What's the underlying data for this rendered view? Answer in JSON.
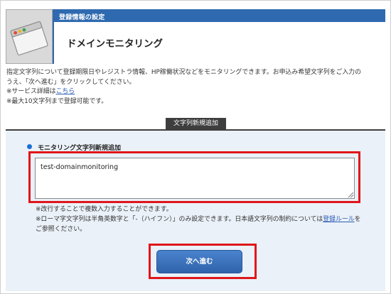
{
  "header": {
    "subtitle": "登録情報の設定",
    "title": "ドメインモニタリング"
  },
  "description": {
    "line1": "指定文字列について登録期限日やレジストラ情報、HP稼働状況などをモニタリングできます。お申込み希望文字列をご入力の",
    "line2": "うえ、「次へ進む」をクリックしてください。",
    "line3_prefix": "※サービス詳細は",
    "line3_link": "こちら",
    "line4": "※最大10文字列まで登録可能です。"
  },
  "form": {
    "section_tab": "文字列新規追加",
    "field_label": "モニタリング文字列新規追加",
    "textarea_value": "test-domainmonitoring",
    "note1": "※改行することで複数入力することができます。",
    "note2_prefix": "※ローマ字文字列は半角英数字と「-（ハイフン）」のみ設定できます。日本語文字列の制約については",
    "note2_link": "登録ルール",
    "note2_suffix": "をご参照ください。",
    "next_button": "次へ進む"
  },
  "colors": {
    "header_blue": "#2f6ab0",
    "form_background": "#eaf1f8",
    "highlight_red": "#e0161b",
    "button_blue": "#2f63ab"
  },
  "icons": {
    "header_icon": "browser-window-icon"
  }
}
